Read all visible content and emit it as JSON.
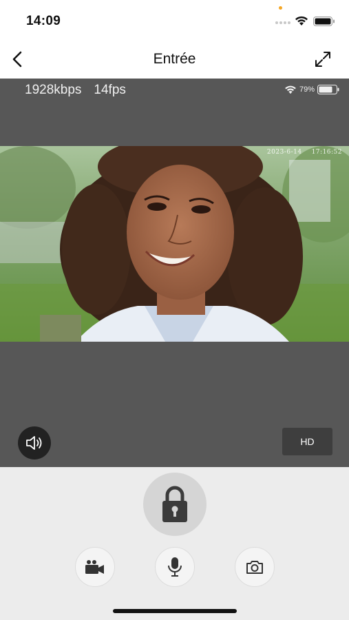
{
  "status_bar": {
    "time": "14:09"
  },
  "nav": {
    "title": "Entrée",
    "back_icon": "chevron-left-icon",
    "expand_icon": "expand-arrows-icon"
  },
  "stream": {
    "bitrate": "1928kbps",
    "framerate": "14fps",
    "camera_battery": "79%",
    "timestamp_date": "2023-6-14",
    "timestamp_time": "17:16:52"
  },
  "controls": {
    "speaker_icon": "speaker-icon",
    "hd_label": "HD",
    "unlock_icon": "lock-icon",
    "record_icon": "video-camera-icon",
    "mic_icon": "microphone-icon",
    "snapshot_icon": "camera-icon"
  },
  "colors": {
    "video_background": "#575757",
    "controls_background": "#ececec",
    "accent_status_dot": "#f5a623"
  }
}
